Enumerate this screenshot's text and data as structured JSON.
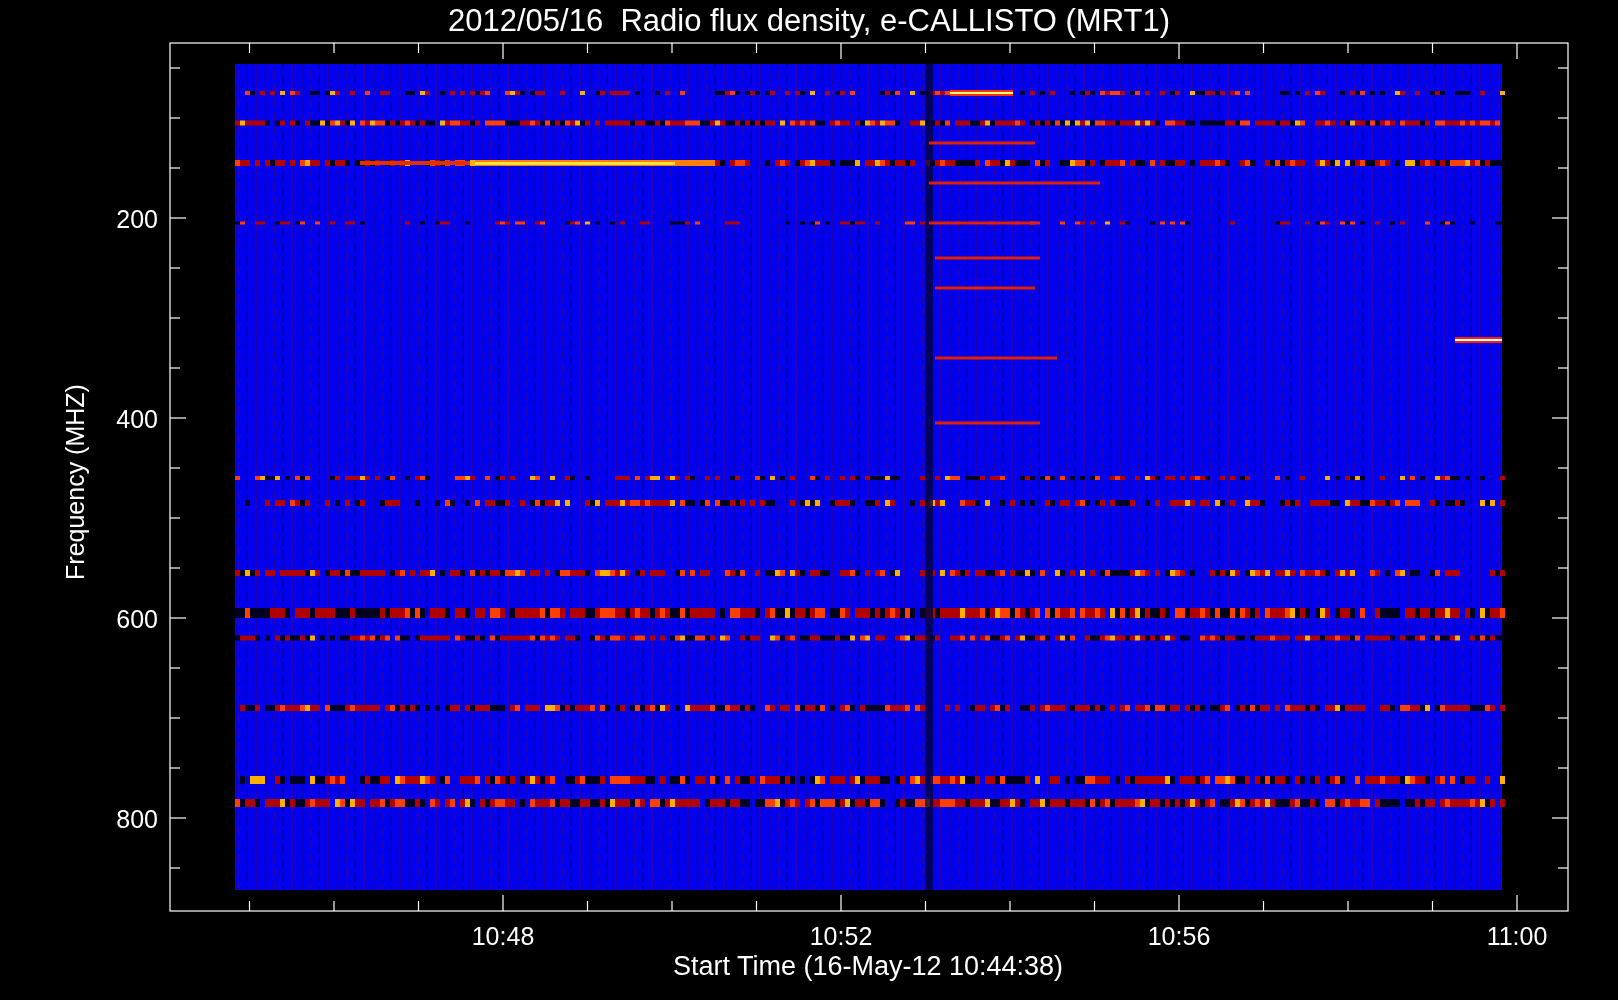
{
  "title": "2012/05/16  Radio flux density, e-CALLISTO (MRT1)",
  "y_axis": {
    "label": "Frequency (MHZ)",
    "ticks": [
      "200",
      "400",
      "600",
      "800"
    ]
  },
  "x_axis": {
    "label": "Start Time (16-May-12 10:44:38)",
    "ticks": [
      "10:48",
      "10:52",
      "10:56",
      "11:00"
    ]
  }
}
